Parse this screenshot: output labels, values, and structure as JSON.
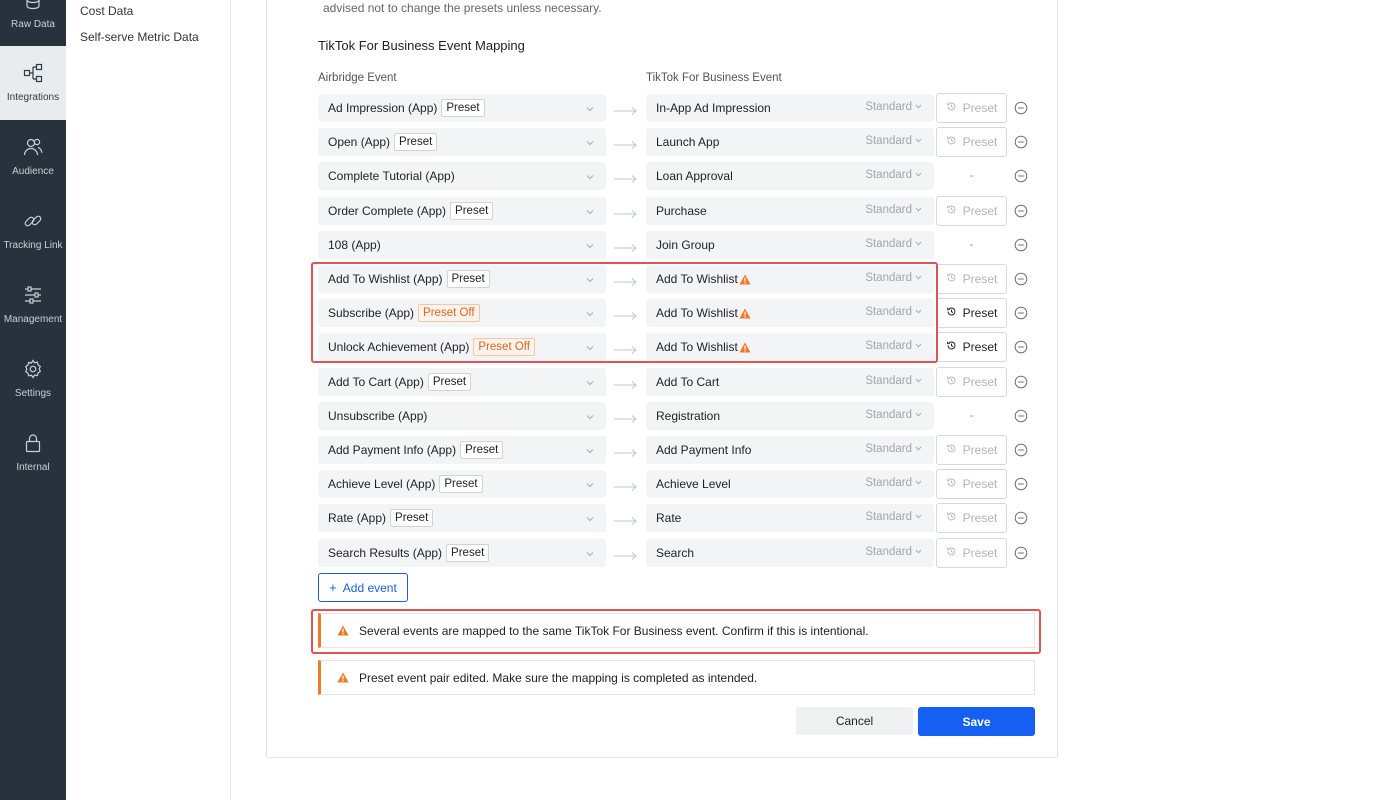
{
  "nav": {
    "items": [
      {
        "label": "Raw Data",
        "icon": "database-icon"
      },
      {
        "label": "Integrations",
        "icon": "integrations-icon",
        "active": true
      },
      {
        "label": "Audience",
        "icon": "users-icon"
      },
      {
        "label": "Tracking Link",
        "icon": "link-icon"
      },
      {
        "label": "Management",
        "icon": "sliders-icon"
      },
      {
        "label": "Settings",
        "icon": "gear-icon"
      },
      {
        "label": "Internal",
        "icon": "lock-icon"
      }
    ]
  },
  "subnav": {
    "items": [
      "Cost Data",
      "Self-serve Metric Data"
    ]
  },
  "main": {
    "note": "advised not to change the presets unless necessary.",
    "section_title": "TikTok For Business Event Mapping",
    "col_source": "Airbridge Event",
    "col_target": "TikTok For Business Event",
    "rows": [
      {
        "src": "Ad Impression (App)",
        "badge": "Preset",
        "badge_off": false,
        "dst": "In-App Ad Impression",
        "warn": false,
        "std": "Standard",
        "preset": "Preset",
        "preset_state": "disabled"
      },
      {
        "src": "Open (App)",
        "badge": "Preset",
        "badge_off": false,
        "dst": "Launch App",
        "warn": false,
        "std": "Standard",
        "preset": "Preset",
        "preset_state": "disabled"
      },
      {
        "src": "Complete Tutorial (App)",
        "badge": "",
        "badge_off": false,
        "dst": "Loan Approval",
        "warn": false,
        "std": "Standard",
        "preset": "-",
        "preset_state": "none"
      },
      {
        "src": "Order Complete (App)",
        "badge": "Preset",
        "badge_off": false,
        "dst": "Purchase",
        "warn": false,
        "std": "Standard",
        "preset": "Preset",
        "preset_state": "disabled"
      },
      {
        "src": "108 (App)",
        "badge": "",
        "badge_off": false,
        "dst": "Join Group",
        "warn": false,
        "std": "Standard",
        "preset": "-",
        "preset_state": "none"
      },
      {
        "src": "Add To Wishlist (App)",
        "badge": "Preset",
        "badge_off": false,
        "dst": "Add To Wishlist",
        "warn": true,
        "std": "Standard",
        "preset": "Preset",
        "preset_state": "disabled"
      },
      {
        "src": "Subscribe (App)",
        "badge": "Preset Off",
        "badge_off": true,
        "dst": "Add To Wishlist",
        "warn": true,
        "std": "Standard",
        "preset": "Preset",
        "preset_state": "enabled"
      },
      {
        "src": "Unlock Achievement (App)",
        "badge": "Preset Off",
        "badge_off": true,
        "dst": "Add To Wishlist",
        "warn": true,
        "std": "Standard",
        "preset": "Preset",
        "preset_state": "enabled"
      },
      {
        "src": "Add To Cart (App)",
        "badge": "Preset",
        "badge_off": false,
        "dst": "Add To Cart",
        "warn": false,
        "std": "Standard",
        "preset": "Preset",
        "preset_state": "disabled"
      },
      {
        "src": "Unsubscribe (App)",
        "badge": "",
        "badge_off": false,
        "dst": "Registration",
        "warn": false,
        "std": "Standard",
        "preset": "-",
        "preset_state": "none"
      },
      {
        "src": "Add Payment Info (App)",
        "badge": "Preset",
        "badge_off": false,
        "dst": "Add Payment Info",
        "warn": false,
        "std": "Standard",
        "preset": "Preset",
        "preset_state": "disabled"
      },
      {
        "src": "Achieve Level (App)",
        "badge": "Preset",
        "badge_off": false,
        "dst": "Achieve Level",
        "warn": false,
        "std": "Standard",
        "preset": "Preset",
        "preset_state": "disabled"
      },
      {
        "src": "Rate (App)",
        "badge": "Preset",
        "badge_off": false,
        "dst": "Rate",
        "warn": false,
        "std": "Standard",
        "preset": "Preset",
        "preset_state": "disabled"
      },
      {
        "src": "Search Results (App)",
        "badge": "Preset",
        "badge_off": false,
        "dst": "Search",
        "warn": false,
        "std": "Standard",
        "preset": "Preset",
        "preset_state": "disabled"
      }
    ],
    "add_event_label": "Add event",
    "alerts": [
      "Several events are mapped to the same TikTok For Business event. Confirm if this is intentional.",
      "Preset event pair edited. Make sure the mapping is completed as intended."
    ],
    "cancel_label": "Cancel",
    "save_label": "Save"
  },
  "colors": {
    "accent": "#1560f2",
    "warning": "#f07a2a",
    "highlight": "#e05353",
    "rail_bg": "#27323d"
  }
}
